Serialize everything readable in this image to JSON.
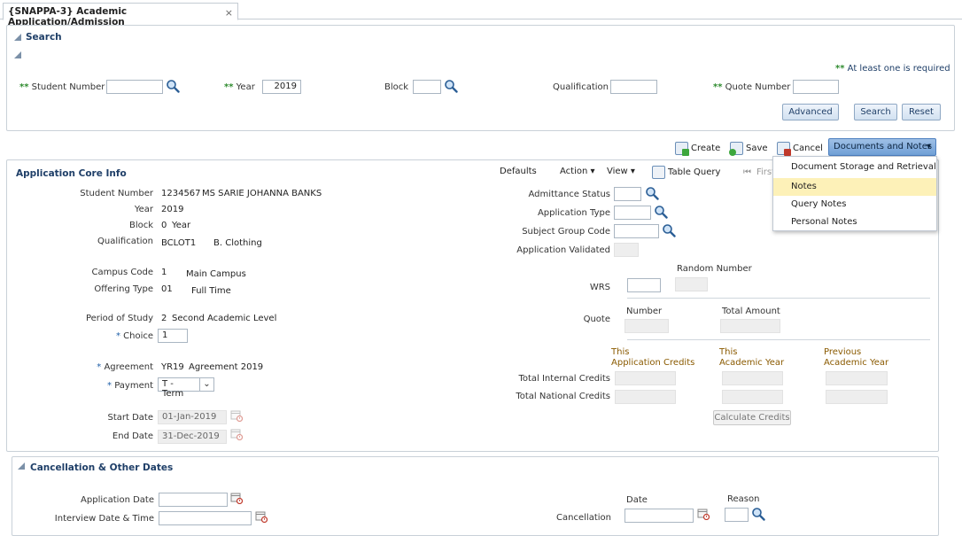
{
  "tab": {
    "title": "{SNAPPA-3} Academic Application/Admission",
    "close": "×"
  },
  "search": {
    "title": "Search",
    "required_marker": "**",
    "required_note": "At least one is required",
    "fields": {
      "student_number": {
        "label": "Student Number",
        "value": ""
      },
      "year": {
        "label": "Year",
        "value": "2019"
      },
      "block": {
        "label": "Block",
        "value": ""
      },
      "qualification": {
        "label": "Qualification",
        "value": ""
      },
      "quote_number": {
        "label": "Quote Number",
        "value": ""
      }
    },
    "buttons": {
      "advanced": "Advanced",
      "search": "Search",
      "reset": "Reset"
    }
  },
  "toolbar": {
    "create": "Create",
    "save": "Save",
    "cancel": "Cancel",
    "docs": "Documents and Notes"
  },
  "docs_menu": [
    "Document Storage and Retrieval",
    "Notes",
    "Query Notes",
    "Personal Notes"
  ],
  "core": {
    "title": "Application Core Info",
    "menubar": {
      "defaults": "Defaults",
      "action": "Action",
      "view": "View",
      "table_query": "Table Query",
      "first": "First"
    },
    "student_number": {
      "label": "Student Number",
      "code": "1234567",
      "name": "MS SARIE JOHANNA BANKS"
    },
    "year": {
      "label": "Year",
      "value": "2019"
    },
    "block": {
      "label": "Block",
      "code": "0",
      "desc": "Year"
    },
    "qualification": {
      "label": "Qualification",
      "code": "BCLOT1",
      "desc": "B. Clothing"
    },
    "campus": {
      "label": "Campus Code",
      "code": "1",
      "desc": "Main Campus"
    },
    "offering": {
      "label": "Offering Type",
      "code": "01",
      "desc": "Full Time"
    },
    "period": {
      "label": "Period of Study",
      "code": "2",
      "desc": "Second Academic Level"
    },
    "choice": {
      "marker": "*",
      "label": "Choice",
      "value": "1"
    },
    "agreement": {
      "marker": "*",
      "label": "Agreement",
      "code": "YR19",
      "desc": "Agreement 2019"
    },
    "payment": {
      "marker": "*",
      "label": "Payment",
      "value": "T - Term"
    },
    "start_date": {
      "label": "Start Date",
      "value": "01-Jan-2019"
    },
    "end_date": {
      "label": "End Date",
      "value": "31-Dec-2019"
    },
    "right": {
      "admittance_status": "Admittance Status",
      "application_type": "Application Type",
      "subject_group_code": "Subject Group Code",
      "application_validated": "Application Validated",
      "random_number": "Random Number",
      "wrs": "WRS",
      "quote": "Quote",
      "number": "Number",
      "total_amount": "Total Amount",
      "col1": [
        "This",
        "Application Credits"
      ],
      "col2": [
        "This",
        "Academic Year"
      ],
      "col3": [
        "Previous",
        "Academic Year"
      ],
      "total_internal": "Total Internal Credits",
      "total_national": "Total National Credits",
      "calculate": "Calculate Credits"
    }
  },
  "cancellation": {
    "title": "Cancellation & Other Dates",
    "application_date": "Application Date",
    "interview": "Interview Date & Time",
    "cancellation": "Cancellation",
    "date": "Date",
    "reason": "Reason"
  },
  "colors": {
    "accent": "#1f3f68",
    "required": "#2e8b2e",
    "header_brown": "#8a5a00",
    "highlight": "#fdf1b8"
  }
}
